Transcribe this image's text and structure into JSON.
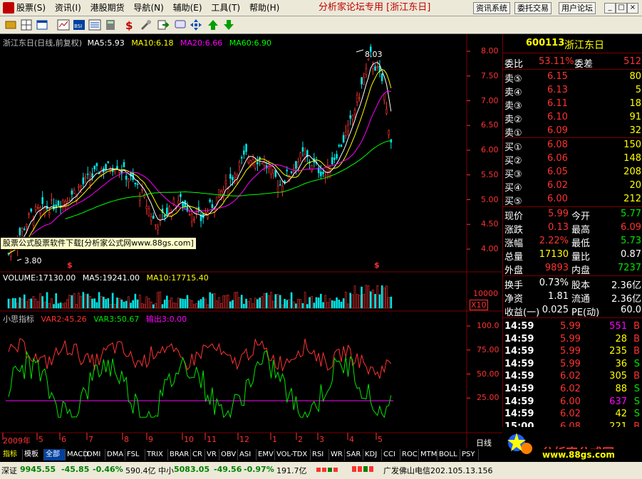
{
  "menu": {
    "items": [
      "股票",
      "资讯",
      "港股期货",
      "导航",
      "辅助",
      "工具",
      "帮助"
    ],
    "item_hotkeys": [
      "(S)",
      "(I)",
      "",
      "(N)",
      "(E)",
      "(T)",
      "(H)"
    ],
    "forum": "分析家论坛专用 [浙江东日]",
    "right_buttons": [
      "资讯系统",
      "委托交易",
      "用户论坛"
    ],
    "window_buttons": [
      "_",
      "□",
      "×"
    ]
  },
  "chart": {
    "title": "浙江东日(日线,前复权)",
    "ma": [
      {
        "label": "MA5:5.93",
        "color": "#ffffff"
      },
      {
        "label": "MA10:6.18",
        "color": "#ffff00"
      },
      {
        "label": "MA20:6.66",
        "color": "#ff00ff"
      },
      {
        "label": "MA60:6.90",
        "color": "#00ff00"
      }
    ],
    "y_ticks": [
      "8.00",
      "7.50",
      "7.00",
      "6.50",
      "6.00",
      "5.50",
      "5.00",
      "4.50",
      "4.00"
    ],
    "y_values": [
      8.0,
      7.5,
      7.0,
      6.5,
      6.0,
      5.5,
      5.0,
      4.5,
      4.0
    ],
    "high_label": "8.03",
    "low_label": "3.80",
    "dividend_marks": [
      "$",
      "$"
    ],
    "banner": "股票公式股票软件下载[分析家公式网www.88gs.com]",
    "volume_title": "VOLUME:17130.00",
    "vol_ma5": "MA5:19241.00",
    "vol_ma10": "MA10:17715.40",
    "vol_tick": "10000",
    "vol_unit": "X10",
    "indicator_title": "小思指标",
    "var2": "VAR2:45.26",
    "var3": "VAR3:50.67",
    "output": "输出3:0.00",
    "ind_ticks": [
      "100.0",
      "75.00",
      "50.00",
      "25.00"
    ],
    "x_labels": [
      "2009年",
      "5",
      "6",
      "7",
      "8",
      "9",
      "10",
      "11",
      "12",
      "1",
      "2",
      "3",
      "4",
      "5"
    ],
    "period": "日线"
  },
  "quote": {
    "code": "600113",
    "name": "浙江东日",
    "weibi_label": "委比",
    "weibi": "53.11%",
    "weicha_label": "委差",
    "weicha": "512",
    "sells": [
      {
        "label": "卖⑤",
        "price": "6.15",
        "vol": "80"
      },
      {
        "label": "卖④",
        "price": "6.13",
        "vol": "5"
      },
      {
        "label": "卖③",
        "price": "6.11",
        "vol": "18"
      },
      {
        "label": "卖②",
        "price": "6.10",
        "vol": "91"
      },
      {
        "label": "卖①",
        "price": "6.09",
        "vol": "32"
      }
    ],
    "buys": [
      {
        "label": "买①",
        "price": "6.08",
        "vol": "150"
      },
      {
        "label": "买②",
        "price": "6.06",
        "vol": "148"
      },
      {
        "label": "买③",
        "price": "6.05",
        "vol": "208"
      },
      {
        "label": "买④",
        "price": "6.02",
        "vol": "20"
      },
      {
        "label": "买⑤",
        "price": "6.00",
        "vol": "212"
      }
    ],
    "stats": [
      {
        "l1": "现价",
        "v1": "5.99",
        "c1": "#ff3232",
        "l2": "今开",
        "v2": "5.77",
        "c2": "#00e600"
      },
      {
        "l1": "涨跌",
        "v1": "0.13",
        "c1": "#ff3232",
        "l2": "最高",
        "v2": "6.09",
        "c2": "#ff3232"
      },
      {
        "l1": "涨幅",
        "v1": "2.22%",
        "c1": "#ff3232",
        "l2": "最低",
        "v2": "5.73",
        "c2": "#00e600"
      },
      {
        "l1": "总量",
        "v1": "17130",
        "c1": "#ffff00",
        "l2": "量比",
        "v2": "0.87",
        "c2": "#ffffff"
      },
      {
        "l1": "外盘",
        "v1": "9893",
        "c1": "#ff3232",
        "l2": "内盘",
        "v2": "7237",
        "c2": "#00e600"
      }
    ],
    "stats2": [
      {
        "l1": "换手",
        "v1": "0.73%",
        "l2": "股本",
        "v2": "2.36亿"
      },
      {
        "l1": "净资",
        "v1": "1.81",
        "l2": "流通",
        "v2": "2.36亿"
      },
      {
        "l1": "收益(一)",
        "v1": "0.025",
        "l2": "PE(动)",
        "v2": "60.0"
      }
    ],
    "ticks": [
      {
        "time": "14:59",
        "price": "5.99",
        "pc": "#ff3232",
        "vol": "551",
        "vc": "#ff00ff",
        "side": "B",
        "sc": "#ff3232"
      },
      {
        "time": "14:59",
        "price": "5.99",
        "pc": "#ff3232",
        "vol": "28",
        "vc": "#ffff00",
        "side": "B",
        "sc": "#ff3232"
      },
      {
        "time": "14:59",
        "price": "5.99",
        "pc": "#ff3232",
        "vol": "235",
        "vc": "#ffff00",
        "side": "B",
        "sc": "#ff3232"
      },
      {
        "time": "14:59",
        "price": "5.99",
        "pc": "#ff3232",
        "vol": "36",
        "vc": "#ffff00",
        "side": "S",
        "sc": "#00e600"
      },
      {
        "time": "14:59",
        "price": "6.02",
        "pc": "#ff3232",
        "vol": "305",
        "vc": "#ffff00",
        "side": "B",
        "sc": "#ff3232"
      },
      {
        "time": "14:59",
        "price": "6.02",
        "pc": "#ff3232",
        "vol": "88",
        "vc": "#ffff00",
        "side": "S",
        "sc": "#00e600"
      },
      {
        "time": "14:59",
        "price": "6.00",
        "pc": "#ff3232",
        "vol": "637",
        "vc": "#ff00ff",
        "side": "S",
        "sc": "#00e600"
      },
      {
        "time": "14:59",
        "price": "6.02",
        "pc": "#ff3232",
        "vol": "42",
        "vc": "#ffff00",
        "side": "S",
        "sc": "#00e600"
      },
      {
        "time": "15:00",
        "price": "6.08",
        "pc": "#ff3232",
        "vol": "221",
        "vc": "#ffff00",
        "side": "B",
        "sc": "#ff3232"
      }
    ]
  },
  "tabs": [
    "指标",
    "模板",
    "全部",
    "MACD",
    "DMI",
    "DMA",
    "FSL",
    "TRIX",
    "BRAR",
    "CR",
    "VR",
    "OBV",
    "ASI",
    "EMV",
    "VOL-TDX",
    "RSI",
    "WR",
    "SAR",
    "KDJ",
    "CCI",
    "ROC",
    "MTM",
    "BOLL",
    "PSY"
  ],
  "status": {
    "sz_label": "深证",
    "sz_value": "9945.55",
    "sz_change": "-45.85",
    "sz_pct": "-0.46%",
    "sz_amount": "590.4亿",
    "zx_label": "中小",
    "zx_value": "5083.05",
    "zx_change": "-49.56",
    "zx_pct": "-0.97%",
    "zx_amount": "191.7亿",
    "server": "广发佛山电信202.105.13.156"
  },
  "logo": {
    "name": "分析家公式网",
    "url": "www.88gs.com"
  }
}
